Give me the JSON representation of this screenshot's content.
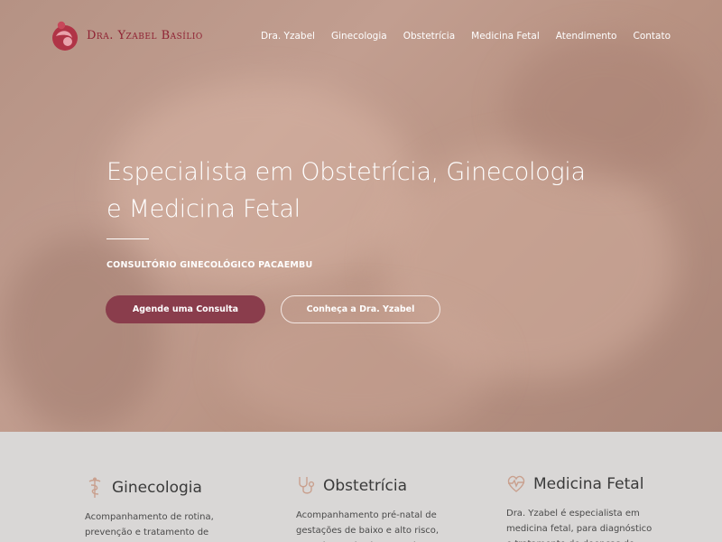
{
  "brand": {
    "name": "Dra. Yzabel Basílio",
    "accent": "#8f2233"
  },
  "nav": {
    "items": [
      "Dra. Yzabel",
      "Ginecologia",
      "Obstetrícia",
      "Medicina Fetal",
      "Atendimento",
      "Contato"
    ]
  },
  "hero": {
    "title_line1": "Especialista em Obstetrícia, Ginecologia",
    "title_line2": "e Medicina Fetal",
    "subtitle": "CONSULTÓRIO GINECOLÓGICO PACAEMBU",
    "primary_button": "Agende uma Consulta",
    "secondary_button": "Conheça a Dra. Yzabel",
    "button_color": "#8a3d4c"
  },
  "services": [
    {
      "icon": "caduceus-icon",
      "title": "Ginecologia",
      "text": "Acompanhamento de rotina, prevenção e tratamento de doenças ginecológicas e DST."
    },
    {
      "icon": "stethoscope-icon",
      "title": "Obstetrícia",
      "text": "Acompanhamento pré-natal de gestações de baixo e alto risco, parto humanizado, normal e cesárea."
    },
    {
      "icon": "heart-pulse-icon",
      "title": "Medicina Fetal",
      "text": "Dra. Yzabel é especialista em medicina fetal, para diagnóstico e tratamento de doenças do bebê."
    }
  ]
}
